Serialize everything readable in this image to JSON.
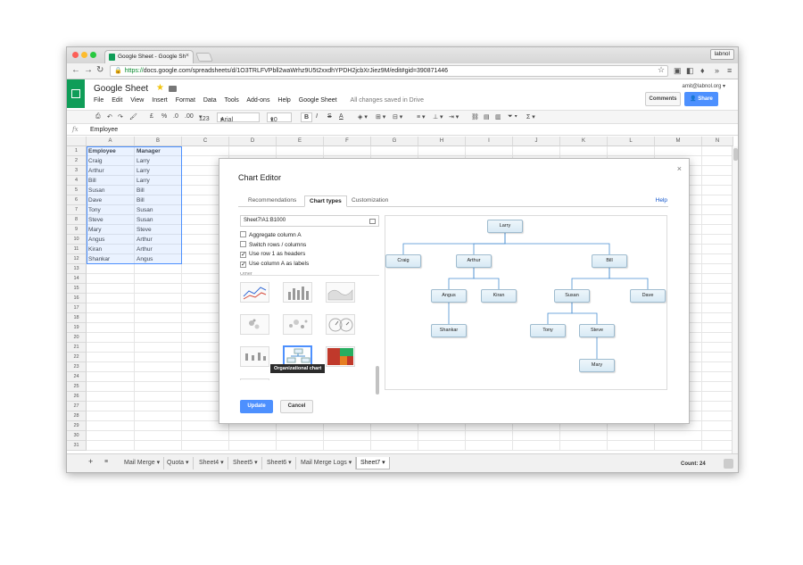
{
  "browser": {
    "tab_title": "Google Sheet - Google Sh",
    "profile": "labnol",
    "url_scheme": "https://",
    "url_rest": "docs.google.com/spreadsheets/d/1O3TRLFVPbll2waWrhz9U5t2xxdhYPDH2jcbXrJiez9M/edit#gid=390871446"
  },
  "docs": {
    "title": "Google Sheet",
    "user_email": "amit@labnol.org",
    "menus": [
      "File",
      "Edit",
      "View",
      "Insert",
      "Format",
      "Data",
      "Tools",
      "Add-ons",
      "Help",
      "Google Sheet"
    ],
    "save_status": "All changes saved in Drive",
    "comments_label": "Comments",
    "share_label": "Share"
  },
  "toolbar": {
    "currency": "£",
    "percent": "%",
    "decimal_dec": ".0",
    "decimal_inc": ".00",
    "more_formats": "123",
    "font": "Arial",
    "font_size": "10",
    "bold": "B",
    "italic": "I",
    "strike": "S",
    "text_color": "A"
  },
  "formula_bar": {
    "fx": "fx",
    "value": "Employee"
  },
  "grid": {
    "columns": [
      "A",
      "B",
      "C",
      "D",
      "E",
      "F",
      "G",
      "H",
      "I",
      "J",
      "K",
      "L",
      "M",
      "N"
    ],
    "rows": [
      [
        "Employee",
        "Manager"
      ],
      [
        "Craig",
        "Larry"
      ],
      [
        "Arthur",
        "Larry"
      ],
      [
        "Bill",
        "Larry"
      ],
      [
        "Susan",
        "Bill"
      ],
      [
        "Dave",
        "Bill"
      ],
      [
        "Tony",
        "Susan"
      ],
      [
        "Steve",
        "Susan"
      ],
      [
        "Mary",
        "Steve"
      ],
      [
        "Angus",
        "Arthur"
      ],
      [
        "Kiran",
        "Arthur"
      ],
      [
        "Shankar",
        "Angus"
      ]
    ],
    "row_numbers": [
      "1",
      "2",
      "3",
      "4",
      "5",
      "6",
      "7",
      "8",
      "9",
      "10",
      "11",
      "12",
      "13",
      "14",
      "15",
      "16",
      "17",
      "18",
      "19",
      "20",
      "21",
      "22",
      "23",
      "24",
      "25",
      "26",
      "27",
      "28",
      "29",
      "30",
      "31"
    ]
  },
  "sheets": {
    "add": "+",
    "list_icon": "≡",
    "tabs": [
      "Mail Merge",
      "Quota",
      "Sheet4",
      "Sheet5",
      "Sheet6",
      "Mail Merge Logs",
      "Sheet7"
    ],
    "active": "Sheet7",
    "count": "Count: 24"
  },
  "chart_editor": {
    "title": "Chart Editor",
    "close": "×",
    "tabs": [
      "Recommendations",
      "Chart types",
      "Customization"
    ],
    "active_tab": "Chart types",
    "help": "Help",
    "range": "Sheet7!A1:B1000",
    "options": [
      {
        "label": "Aggregate column A",
        "checked": false
      },
      {
        "label": "Switch rows / columns",
        "checked": false
      },
      {
        "label": "Use row 1 as headers",
        "checked": true
      },
      {
        "label": "Use column A as labels",
        "checked": true
      }
    ],
    "section_label": "Other",
    "tooltip": "Organizational chart",
    "update": "Update",
    "cancel": "Cancel",
    "org_nodes": [
      "Larry",
      "Craig",
      "Arthur",
      "Bill",
      "Angus",
      "Kiran",
      "Susan",
      "Dave",
      "Shankar",
      "Tony",
      "Steve",
      "Mary"
    ]
  }
}
